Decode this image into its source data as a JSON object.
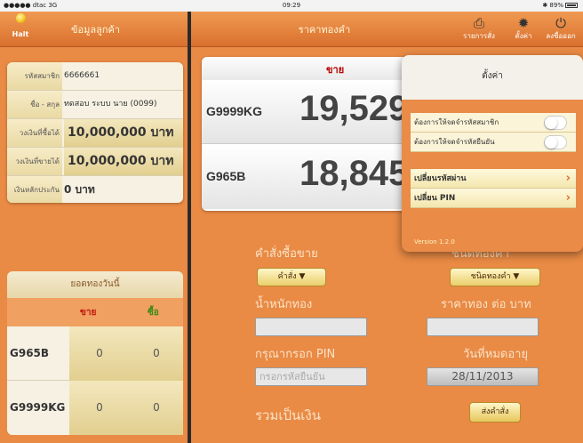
{
  "status_bar": {
    "carrier": "●●●●● dtac  3G",
    "time": "09:29",
    "battery": "✱ 89%"
  },
  "left_panel": {
    "halt_label": "Halt",
    "title": "ข้อมูลลูกค้า",
    "member": {
      "rows": [
        {
          "key": "รหัสสมาชิก",
          "value": "6666661"
        },
        {
          "key": "ชื่อ - สกุล",
          "value": "ทดสอบ ระบบ นาย (0099)"
        },
        {
          "key": "วงเงินที่ซื้อได้",
          "value": "10,000,000 บาท"
        },
        {
          "key": "วงเงินที่ขายได้",
          "value": "10,000,000 บาท"
        },
        {
          "key": "เงินหลักประกัน",
          "value": "0 บาท"
        }
      ]
    },
    "today": {
      "title": "ยอดทองวันนี้",
      "sell_label": "ขาย",
      "buy_label": "ซื้อ",
      "rows": [
        {
          "name": "G965B",
          "sell": "0",
          "buy": "0"
        },
        {
          "name": "G9999KG",
          "sell": "0",
          "buy": "0"
        }
      ]
    }
  },
  "right_panel": {
    "title": "ราคาทองคำ",
    "buttons": {
      "report": "รายการสั่ง",
      "settings": "ตั้งค่า",
      "logout": "ลงชื่อออก"
    },
    "price": {
      "sell_header": "ขาย",
      "rows": [
        {
          "name": "G9999KG",
          "price": "19,529"
        },
        {
          "name": "G965B",
          "price": "18,845"
        }
      ]
    },
    "order": {
      "command_label": "คำสั่งซื้อขาย",
      "command_dropdown": "คำสั่ง ▼",
      "gold_type_label": "ชนิดทองคำ",
      "gold_type_dropdown": "ชนิดทองคำ ▼",
      "weight_label": "น้ำหนักทอง",
      "price_per_baht_label": "ราคาทอง ต่อ บาท",
      "pin_label": "กรุณากรอก PIN",
      "pin_placeholder": "กรอกรหัสยืนยัน",
      "expiry_label": "วันที่หมดอายุ",
      "expiry_value": "28/11/2013",
      "total_label": "รวมเป็นเงิน",
      "send_button": "ส่งคำสั่ง"
    }
  },
  "settings_popover": {
    "title": "ตั้งค่า",
    "toggles": [
      "ต้องการให้จดจำรหัสสมาชิก",
      "ต้องการให้จดจำรหัสยืนยัน"
    ],
    "links": [
      "เปลี่ยนรหัสผ่าน",
      "เปลี่ยน PIN"
    ],
    "version": "Version 1.2.0"
  }
}
